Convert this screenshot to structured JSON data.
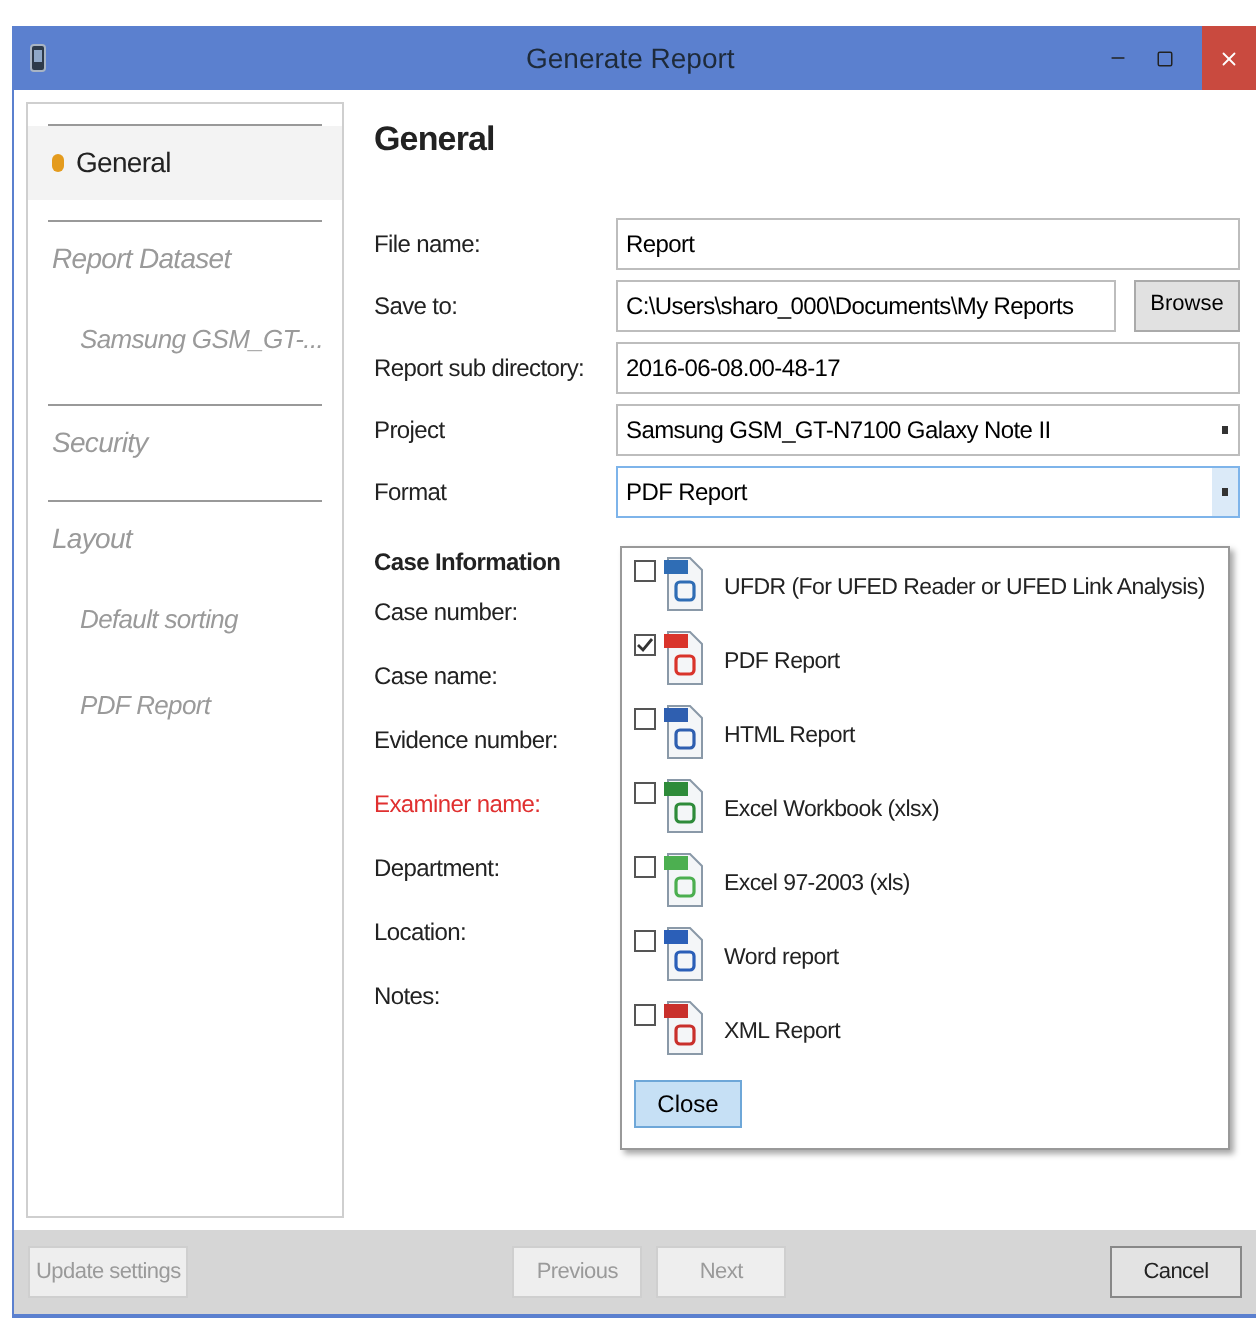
{
  "window": {
    "title": "Generate Report"
  },
  "sidebar": {
    "items": [
      {
        "label": "General",
        "selected": true
      },
      {
        "label": "Report Dataset",
        "selected": false,
        "children": [
          {
            "label": "Samsung GSM_GT-...",
            "selected": false
          }
        ]
      },
      {
        "label": "Security",
        "selected": false
      },
      {
        "label": "Layout",
        "selected": false,
        "children": [
          {
            "label": "Default sorting",
            "selected": false
          },
          {
            "label": "PDF Report",
            "selected": false
          }
        ]
      }
    ]
  },
  "heading": "General",
  "fields": [
    {
      "label": "File name:",
      "kind": "text",
      "value": "Report"
    },
    {
      "label": "Save to:",
      "kind": "browse",
      "value": "C:\\Users\\sharo_000\\Documents\\My Reports",
      "button": "Browse"
    },
    {
      "label": "Report sub directory:",
      "kind": "text",
      "value": "2016-06-08.00-48-17"
    },
    {
      "label": "Project",
      "kind": "select",
      "value": "Samsung GSM_GT-N7100 Galaxy Note II",
      "expanded": false
    },
    {
      "label": "Format",
      "kind": "select",
      "value": "PDF Report",
      "expanded": true
    }
  ],
  "case_information": {
    "title": "Case Information",
    "labels": [
      {
        "label": "Case number:",
        "required": false
      },
      {
        "label": "Case name:",
        "required": false
      },
      {
        "label": "Evidence number:",
        "required": false
      },
      {
        "label": "Examiner name:",
        "required": true
      },
      {
        "label": "Department:",
        "required": false
      },
      {
        "label": "Location:",
        "required": false
      },
      {
        "label": "Notes:",
        "required": false
      }
    ]
  },
  "format_options": [
    {
      "label": "UFDR (For UFED Reader or UFED Link Analysis)",
      "kind": "ufdr",
      "checked": false
    },
    {
      "label": "PDF Report",
      "kind": "pdf",
      "checked": true
    },
    {
      "label": "HTML Report",
      "kind": "html",
      "checked": false
    },
    {
      "label": "Excel Workbook (xlsx)",
      "kind": "xlsx",
      "checked": false
    },
    {
      "label": "Excel 97-2003 (xls)",
      "kind": "xls",
      "checked": false
    },
    {
      "label": "Word report",
      "kind": "word",
      "checked": false
    },
    {
      "label": "XML Report",
      "kind": "xml",
      "checked": false
    }
  ],
  "close_button": "Close",
  "footer": [
    {
      "label": "Update settings",
      "disabled": true,
      "kind": "left"
    },
    {
      "label": "Previous",
      "disabled": true,
      "kind": "nav"
    },
    {
      "label": "Next",
      "disabled": true,
      "kind": "nav"
    },
    {
      "label": "Cancel",
      "disabled": false,
      "kind": "right"
    }
  ]
}
